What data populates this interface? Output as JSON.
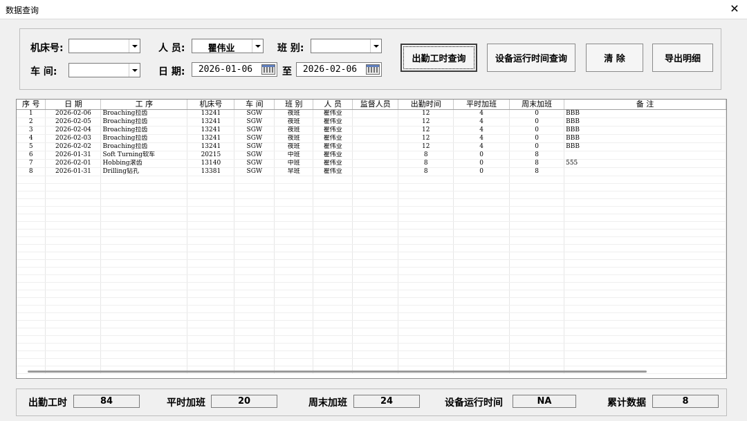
{
  "window": {
    "title": "数据查询",
    "close_icon": "close-icon"
  },
  "filters": {
    "machine_no_label": "机床号:",
    "machine_no_value": "",
    "person_label": "人  员:",
    "person_value": "瞿伟业",
    "shift_label": "班  别:",
    "shift_value": "",
    "workshop_label": "车  间:",
    "workshop_value": "",
    "date_label": "日  期:",
    "date_from": "2026-01-06",
    "date_to_label": "至",
    "date_to": "2026-02-06"
  },
  "buttons": {
    "attendance_query": "出勤工时查询",
    "equipment_runtime_query": "设备运行时间查询",
    "clear": "清  除",
    "export_detail": "导出明细"
  },
  "grid": {
    "columns": [
      "序 号",
      "日  期",
      "工 序",
      "机床号",
      "车 间",
      "班 别",
      "人 员",
      "监督人员",
      "出勤时间",
      "平时加班",
      "周末加班",
      "备 注"
    ],
    "rows": [
      [
        "1",
        "2026-02-06",
        "Broaching拉齿",
        "13241",
        "SGW",
        "夜班",
        "瞿伟业",
        "",
        "12",
        "4",
        "0",
        "BBB"
      ],
      [
        "2",
        "2026-02-05",
        "Broaching拉齿",
        "13241",
        "SGW",
        "夜班",
        "瞿伟业",
        "",
        "12",
        "4",
        "0",
        "BBB"
      ],
      [
        "3",
        "2026-02-04",
        "Broaching拉齿",
        "13241",
        "SGW",
        "夜班",
        "瞿伟业",
        "",
        "12",
        "4",
        "0",
        "BBB"
      ],
      [
        "4",
        "2026-02-03",
        "Broaching拉齿",
        "13241",
        "SGW",
        "夜班",
        "瞿伟业",
        "",
        "12",
        "4",
        "0",
        "BBB"
      ],
      [
        "5",
        "2026-02-02",
        "Broaching拉齿",
        "13241",
        "SGW",
        "夜班",
        "瞿伟业",
        "",
        "12",
        "4",
        "0",
        "BBB"
      ],
      [
        "6",
        "2026-01-31",
        "Soft Turning软车",
        "20215",
        "SGW",
        "中班",
        "瞿伟业",
        "",
        "8",
        "0",
        "8",
        ""
      ],
      [
        "7",
        "2026-02-01",
        "Hobbing滚齿",
        "13140",
        "SGW",
        "中班",
        "瞿伟业",
        "",
        "8",
        "0",
        "8",
        "555"
      ],
      [
        "8",
        "2026-01-31",
        "Drilling钻孔",
        "13381",
        "SGW",
        "早班",
        "瞿伟业",
        "",
        "8",
        "0",
        "8",
        ""
      ]
    ]
  },
  "summary": {
    "attendance_hours_label": "出勤工时",
    "attendance_hours_value": "84",
    "weekday_overtime_label": "平时加班",
    "weekday_overtime_value": "20",
    "weekend_overtime_label": "周末加班",
    "weekend_overtime_value": "24",
    "equipment_runtime_label": "设备运行时间",
    "equipment_runtime_value": "NA",
    "total_records_label": "累计数据",
    "total_records_value": "8"
  }
}
